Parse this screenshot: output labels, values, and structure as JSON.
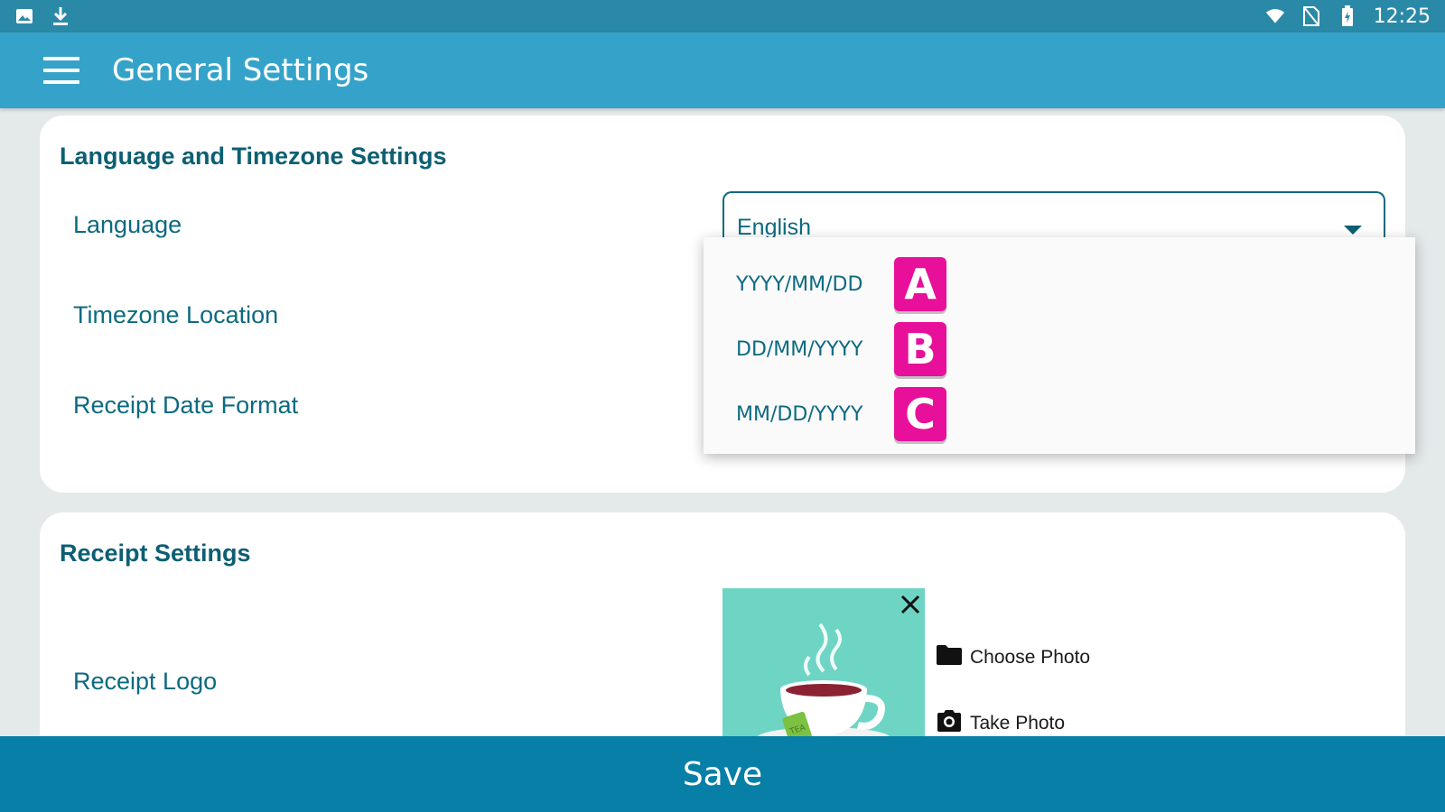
{
  "status_bar": {
    "time": "12:25",
    "icons": [
      "image-icon",
      "download-icon",
      "wifi-icon",
      "no-sim-icon",
      "battery-charging-icon"
    ]
  },
  "app_bar": {
    "title": "General Settings"
  },
  "language_section": {
    "title": "Language and Timezone Settings",
    "language_label": "Language",
    "language_value": "English",
    "timezone_label": "Timezone Location",
    "date_format_label": "Receipt Date Format",
    "date_format_options": [
      {
        "label": "YYYY/MM/DD",
        "badge": "A"
      },
      {
        "label": "DD/MM/YYYY",
        "badge": "B"
      },
      {
        "label": "MM/DD/YYYY",
        "badge": "C"
      }
    ]
  },
  "receipt_section": {
    "title": "Receipt Settings",
    "logo_label": "Receipt Logo",
    "logo_text": "TEA",
    "choose_photo": "Choose Photo",
    "take_photo": "Take Photo"
  },
  "save_label": "Save",
  "colors": {
    "status_bar": "#2b89a8",
    "app_bar": "#35a3c9",
    "save_bar": "#077fa6",
    "text_primary": "#0c5f73",
    "badge": "#e8109a",
    "logo_bg": "#6ed5c4"
  }
}
